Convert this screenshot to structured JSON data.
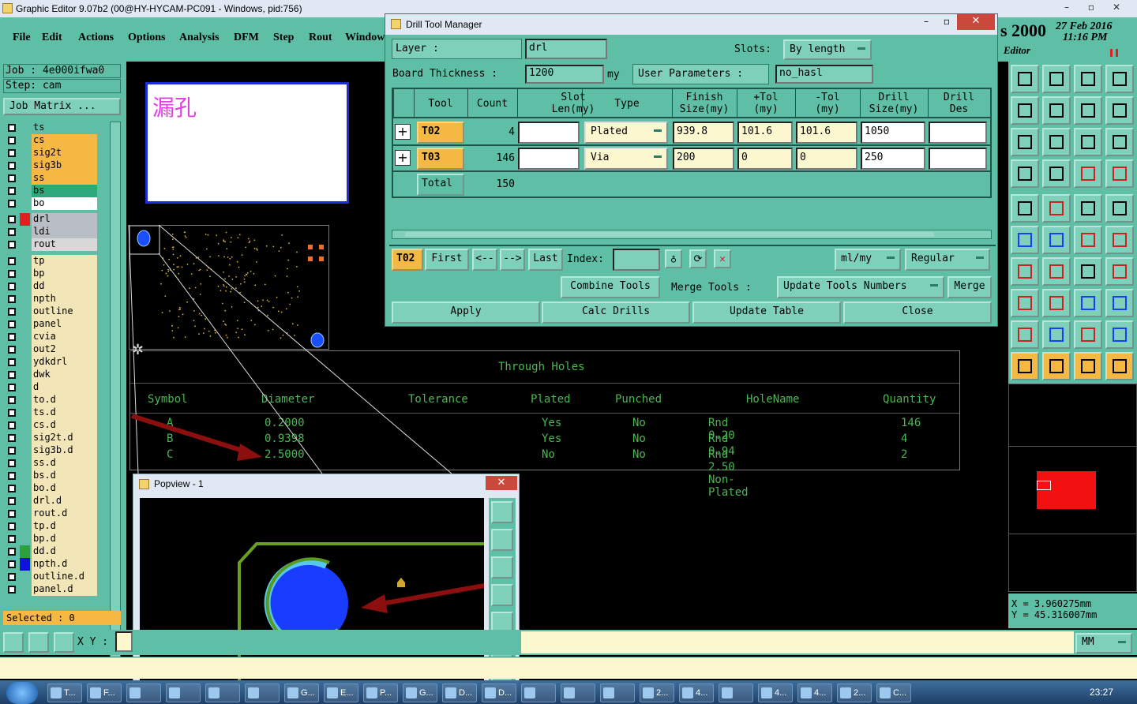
{
  "main_window": {
    "title": "Graphic Editor 9.07b2 (00@HY-HYCAM-PC091 - Windows, pid:756)",
    "date": "27 Feb 2016",
    "time": "11:16 PM",
    "year_partial": "s 2000",
    "editor_label": "Editor"
  },
  "menu": [
    "File",
    "Edit",
    "Actions",
    "Options",
    "Analysis",
    "DFM",
    "Step",
    "Rout",
    "Window"
  ],
  "left_panel": {
    "job": "Job : 4e000ifwa0",
    "step": "Step: cam",
    "job_matrix": "Job Matrix ...",
    "layers_group1": [
      {
        "name": "ts",
        "color": "#5ebfa6"
      },
      {
        "name": "cs",
        "color": "#f4b843"
      },
      {
        "name": "sig2t",
        "color": "#f4b843"
      },
      {
        "name": "sig3b",
        "color": "#f4b843"
      },
      {
        "name": "ss",
        "color": "#f4b843"
      },
      {
        "name": "bs",
        "color": "#2ca87a"
      },
      {
        "name": "bo",
        "color": "#ffffff"
      }
    ],
    "layers_group2": [
      {
        "name": "drl",
        "color": "#b9bec4",
        "swatch": "#e02020"
      },
      {
        "name": "ldi",
        "color": "#b9bec4"
      },
      {
        "name": "rout",
        "color": "#d8d8d8"
      }
    ],
    "layers_group3": [
      "tp",
      "bp",
      "dd",
      "npth",
      "outline",
      "panel",
      "cvia",
      "out2",
      "ydkdrl",
      "dwk",
      "d",
      "to.d",
      "ts.d",
      "cs.d",
      "sig2t.d",
      "sig3b.d",
      "ss.d",
      "bs.d",
      "bo.d",
      "drl.d",
      "rout.d",
      "tp.d",
      "bp.d",
      "dd.d",
      "npth.d",
      "outline.d",
      "panel.d"
    ],
    "selected": "Selected : 0"
  },
  "bottom": {
    "xy_label": "X Y :",
    "units": "MM"
  },
  "coords": {
    "x": "X = 3.960275mm",
    "y": "Y = 45.316007mm"
  },
  "viewer_text": "漏孔",
  "drill_tool_manager": {
    "title": "Drill Tool Manager",
    "layer_label": "Layer      :",
    "layer_value": "drl",
    "slots_label": "Slots:",
    "slots_value": "By length",
    "board_thickness_label": "Board Thickness :",
    "board_thickness_value": "1200",
    "board_thickness_unit": "my",
    "user_params_label": "User Parameters :",
    "user_params_value": "no_hasl",
    "columns": [
      "Tool",
      "Count",
      "Slot Len(my)",
      "Type",
      "Finish Size(my)",
      "+Tol (my)",
      "-Tol (my)",
      "Drill Size(my)",
      "Drill Des"
    ],
    "rows": [
      {
        "tool": "T02",
        "count": "4",
        "slot": "",
        "type": "Plated",
        "finish": "939.8",
        "ptol": "101.6",
        "mtol": "101.6",
        "drill": "1050",
        "des": ""
      },
      {
        "tool": "T03",
        "count": "146",
        "slot": "",
        "type": "Via",
        "finish": "200",
        "ptol": "0",
        "mtol": "0",
        "drill": "250",
        "des": ""
      }
    ],
    "total_label": "Total",
    "total_value": "150",
    "current_tool": "T02",
    "nav": {
      "first": "First",
      "prev": "<--",
      "next": "-->",
      "last": "Last",
      "index": "Index:"
    },
    "units_select": "ml/my",
    "mode_select": "Regular",
    "combine": "Combine Tools",
    "merge_tools": "Merge Tools :",
    "update_numbers": "Update Tools Numbers",
    "merge": "Merge",
    "apply": "Apply",
    "calc": "Calc Drills",
    "update_table": "Update Table",
    "close": "Close"
  },
  "through_holes": {
    "title": "Through Holes",
    "headers": [
      "Symbol",
      "Diameter",
      "Tolerance",
      "Plated",
      "Punched",
      "HoleName",
      "Quantity"
    ],
    "rows": [
      [
        "A",
        "0.2000",
        "",
        "Yes",
        "No",
        "Rnd 0.20",
        "146"
      ],
      [
        "B",
        "0.9398",
        "",
        "Yes",
        "No",
        "Rnd 0.94",
        "4"
      ],
      [
        "C",
        "2.5000",
        "",
        "No",
        "No",
        "Rnd 2.50 Non-Plated",
        "2"
      ]
    ]
  },
  "popview": {
    "title": "Popview - 1"
  },
  "taskbar": {
    "items": [
      "T...",
      "F...",
      "",
      "",
      "",
      "",
      "G...",
      "E...",
      "P...",
      "G...",
      "D...",
      "D...",
      "",
      "",
      "",
      "2...",
      "4...",
      "",
      "4...",
      "4...",
      "2...",
      "C..."
    ],
    "clock": "23:27"
  }
}
